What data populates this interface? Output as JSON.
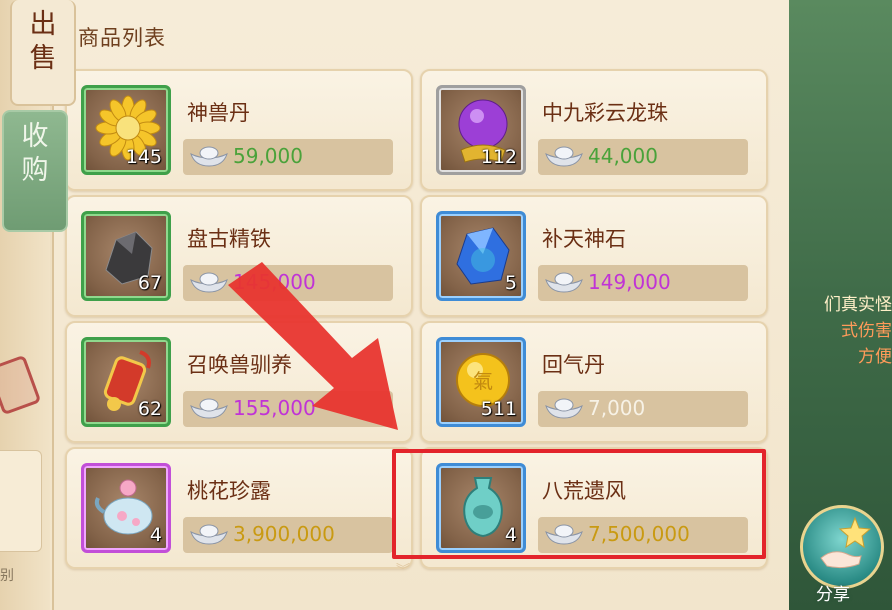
{
  "panel": {
    "title": "商品列表"
  },
  "items": [
    {
      "name": "神兽丹",
      "qty": "145",
      "price": "59,000",
      "rarity": "green",
      "price_color": "green",
      "icon": "golden-sunflower-icon"
    },
    {
      "name": "中九彩云龙珠",
      "qty": "112",
      "price": "44,000",
      "rarity": "gray",
      "price_color": "green",
      "icon": "purple-dragon-orb-icon"
    },
    {
      "name": "盘古精铁",
      "qty": "67",
      "price": "145,000",
      "rarity": "green",
      "price_color": "purple",
      "icon": "black-iron-ore-icon"
    },
    {
      "name": "补天神石",
      "qty": "5",
      "price": "149,000",
      "rarity": "blue",
      "price_color": "purple",
      "icon": "blue-crystal-stone-icon"
    },
    {
      "name": "召唤兽驯养",
      "qty": "62",
      "price": "155,000",
      "rarity": "green",
      "price_color": "purple",
      "icon": "red-scroll-token-icon"
    },
    {
      "name": "回气丹",
      "qty": "511",
      "price": "7,000",
      "rarity": "blue",
      "price_color": "white",
      "icon": "golden-qi-pill-icon"
    },
    {
      "name": "桃花珍露",
      "qty": "4",
      "price": "3,900,000",
      "rarity": "purple",
      "price_color": "yellow",
      "icon": "peach-blossom-teapot-icon"
    },
    {
      "name": "八荒遗风",
      "qty": "4",
      "price": "7,500,000",
      "rarity": "blue",
      "price_color": "yellow",
      "icon": "jade-vase-icon"
    }
  ],
  "tabs": {
    "sell": "出\n售",
    "buy": "收\n购"
  },
  "side_tip": {
    "line1": "们真实怪",
    "line2": "式伤害",
    "line3": "方便"
  },
  "share": {
    "label": "分享"
  },
  "left_partial": "别",
  "colors": {
    "highlight": "#e3242b",
    "arrow": "#e8352f"
  }
}
